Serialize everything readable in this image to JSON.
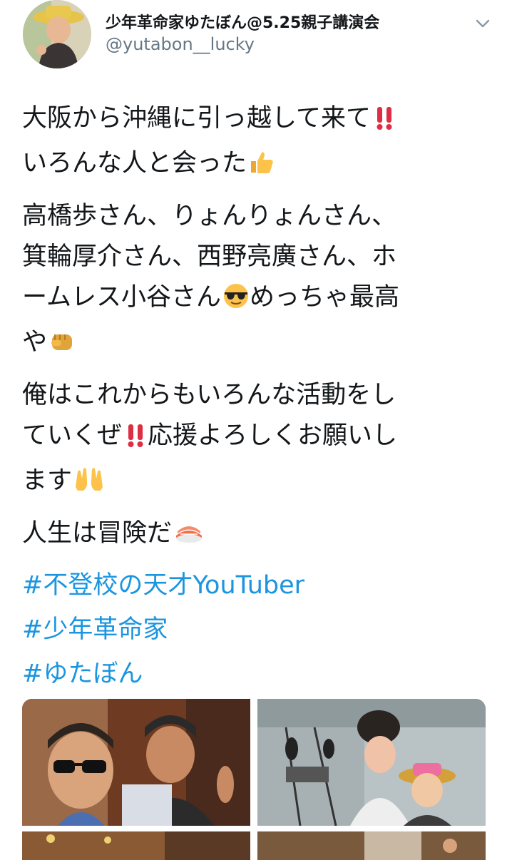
{
  "tweet": {
    "author_name": "少年革命家ゆたぼん@5.25親子講演会",
    "author_handle": "@yutabon__lucky",
    "paragraphs": [
      {
        "line1": "大阪から沖縄に引っ越して来て",
        "line2": "いろんな人と会った"
      },
      {
        "line1": "高橋歩さん、りょんりょんさん、",
        "line2": "箕輪厚介さん、西野亮廣さん、ホ",
        "line3": "ームレス小谷さん",
        "line3b": "めっちゃ最高",
        "line4": "や"
      },
      {
        "line1": "俺はこれからもいろんな活動をし",
        "line2a": "ていくぜ",
        "line2b": "応援よろしくお願いし",
        "line3": "ます"
      },
      {
        "line1": "人生は冒険だ"
      }
    ],
    "hashtags": [
      "#不登校の天才YouTuber",
      "#少年革命家",
      "#ゆたぼん"
    ],
    "emoji": [
      "double-exclamation",
      "thumbs-up",
      "sunglasses-face",
      "fist",
      "raised-hands",
      "sushi"
    ]
  }
}
